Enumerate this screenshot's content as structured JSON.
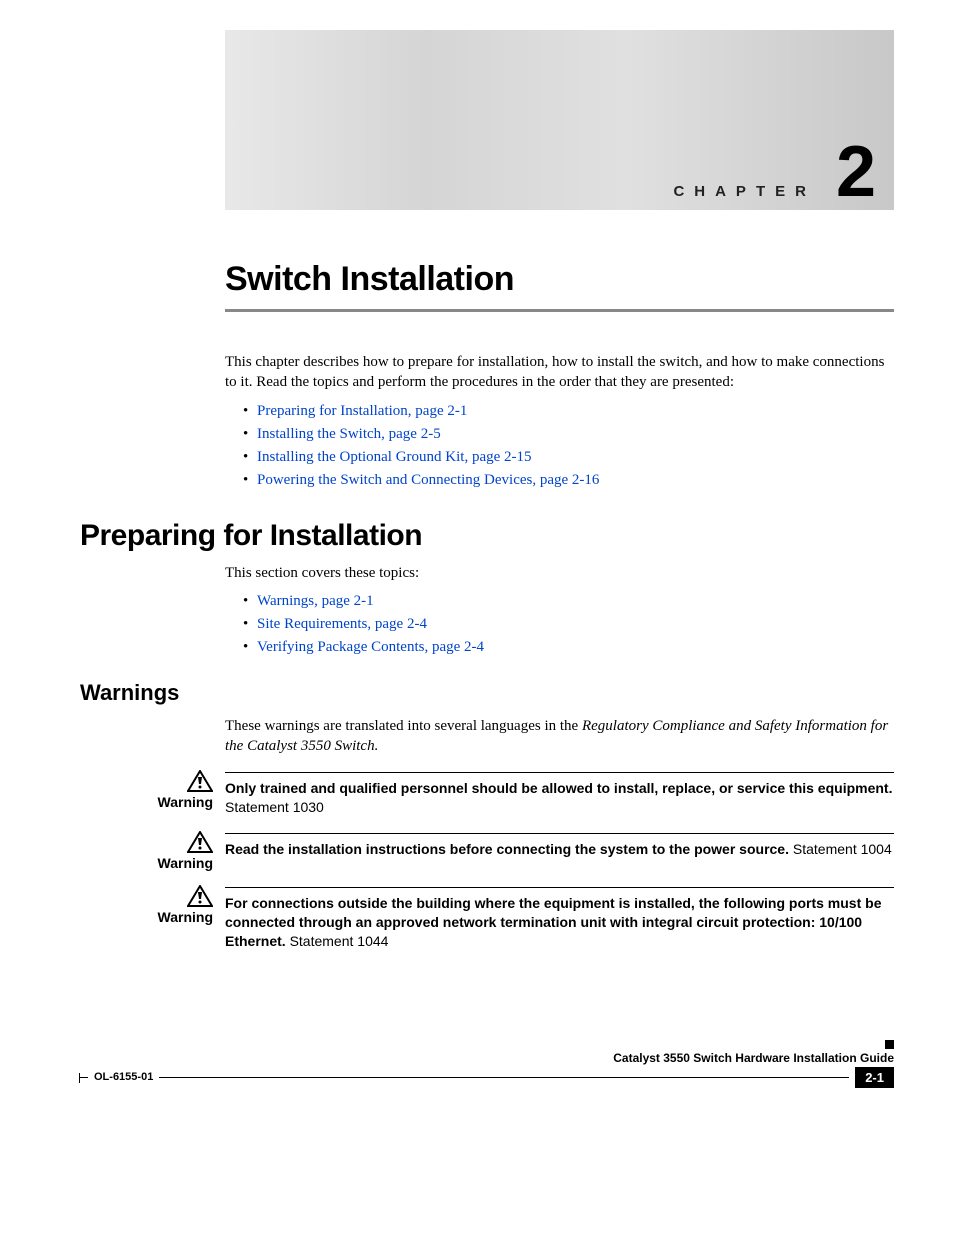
{
  "banner": {
    "chapter_label": "CHAPTER",
    "chapter_number": "2"
  },
  "chapter_title": "Switch Installation",
  "intro_paragraph": "This chapter describes how to prepare for installation, how to install the switch, and how to make connections to it. Read the topics and perform the procedures in the order that they are presented:",
  "intro_toc": [
    "Preparing for Installation, page 2-1",
    "Installing the Switch, page 2-5",
    "Installing the Optional Ground Kit, page 2-15",
    "Powering the Switch and Connecting Devices, page 2-16"
  ],
  "section_preparing": {
    "heading": "Preparing for Installation",
    "intro": "This section covers these topics:",
    "toc": [
      "Warnings, page 2-1",
      "Site Requirements, page 2-4",
      "Verifying Package Contents, page 2-4"
    ]
  },
  "section_warnings": {
    "heading": "Warnings",
    "intro_prefix": "These warnings are translated into several languages in the ",
    "intro_italic": "Regulatory Compliance and Safety Information for the Catalyst 3550 Switch.",
    "label": "Warning",
    "items": [
      {
        "bold": "Only trained and qualified personnel should be allowed to install, replace, or service this equipment.",
        "rest": " Statement 1030"
      },
      {
        "bold": "Read the installation instructions before connecting the system to the power source.",
        "rest": " Statement 1004"
      },
      {
        "bold": "For connections outside the building where the equipment is installed, the following ports must be connected through an approved network termination unit with integral circuit protection: 10/100 Ethernet.",
        "rest": " Statement 1044"
      }
    ]
  },
  "footer": {
    "guide_title": "Catalyst 3550 Switch Hardware Installation Guide",
    "doc_id": "OL-6155-01",
    "page_number": "2-1"
  }
}
